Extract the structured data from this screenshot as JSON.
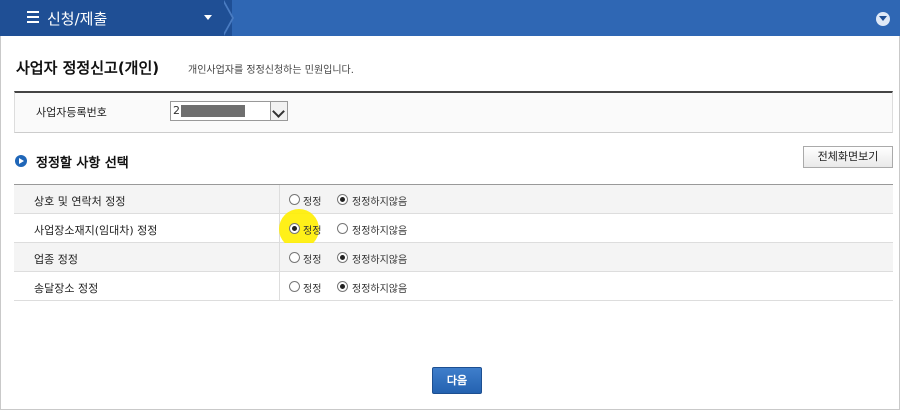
{
  "topbar": {
    "menu_title": "신청/제출",
    "colors": {
      "bar": "#2f67b4",
      "tab": "#1f4f95"
    }
  },
  "page": {
    "title": "사업자 정정신고(개인)",
    "description": "개인사업자를 정정신청하는 민원입니다."
  },
  "registration": {
    "label": "사업자등록번호",
    "value": "2"
  },
  "section": {
    "title": "정정할 사항 선택",
    "fullview_label": "전체화면보기"
  },
  "options": [
    {
      "label": "상호 및 연락처 정정",
      "opt1": "정정",
      "opt2": "정정하지않음",
      "selected": "opt2"
    },
    {
      "label": "사업장소재지(임대차) 정정",
      "opt1": "정정",
      "opt2": "정정하지않음",
      "selected": "opt1"
    },
    {
      "label": "업종 정정",
      "opt1": "정정",
      "opt2": "정정하지않음",
      "selected": "opt2"
    },
    {
      "label": "송달장소 정정",
      "opt1": "정정",
      "opt2": "정정하지않음",
      "selected": "opt2"
    }
  ],
  "footer": {
    "next_label": "다음",
    "accent": "#2462b0"
  }
}
